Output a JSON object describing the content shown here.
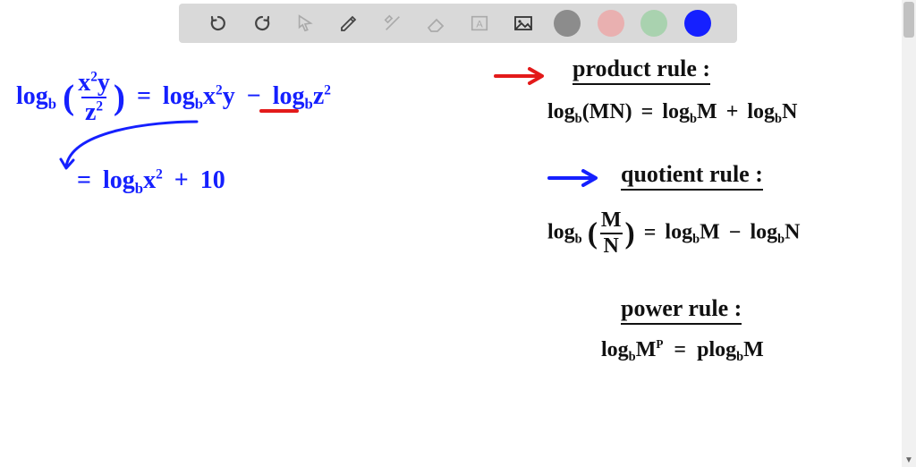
{
  "toolbar": {
    "undo": "↺",
    "redo": "↻",
    "pointer": "↖",
    "pencil": "✎",
    "tools": "✕",
    "eraser": "▭",
    "textbox": "A",
    "image": "🖼",
    "swatches": {
      "gray": "#8c8c8c",
      "pink": "#e9b0b0",
      "green": "#a9d2af",
      "blue": "#1520ff"
    }
  },
  "work": {
    "line1_lhs_log": "log",
    "line1_lhs_frac_num_a": "x",
    "line1_lhs_frac_num_a_exp": "2",
    "line1_lhs_frac_num_b": "y",
    "line1_lhs_frac_den": "z",
    "line1_lhs_frac_den_exp": "2",
    "eq": "=",
    "line1_rhs_t1_log": "log",
    "line1_rhs_t1_arg_a": "x",
    "line1_rhs_t1_arg_a_exp": "2",
    "line1_rhs_t1_arg_b": "y",
    "minus": "−",
    "line1_rhs_t2_log": "log",
    "line1_rhs_t2_arg": "z",
    "line1_rhs_t2_arg_exp": "2",
    "line2_log": "log",
    "line2_arg": "x",
    "line2_arg_exp": "2",
    "plus": "+",
    "line2_tail": "10",
    "base_b": "b"
  },
  "rules": {
    "product": {
      "title": "product rule :",
      "lhs_log": "log",
      "lhs_arg": "(MN)",
      "eq": "=",
      "rhs1_log": "log",
      "rhs1_arg": "M",
      "plus": "+",
      "rhs2_log": "log",
      "rhs2_arg": "N"
    },
    "quotient": {
      "title": "quotient rule :",
      "lhs_log": "log",
      "lhs_frac_num": "M",
      "lhs_frac_den": "N",
      "eq": "=",
      "rhs1_log": "log",
      "rhs1_arg": "M",
      "minus": "−",
      "rhs2_log": "log",
      "rhs2_arg": "N"
    },
    "power": {
      "title": "power rule :",
      "lhs_log": "log",
      "lhs_arg": "M",
      "lhs_exp": "P",
      "eq": "=",
      "rhs_coeff": "p",
      "rhs_log": "log",
      "rhs_arg": "M"
    }
  }
}
